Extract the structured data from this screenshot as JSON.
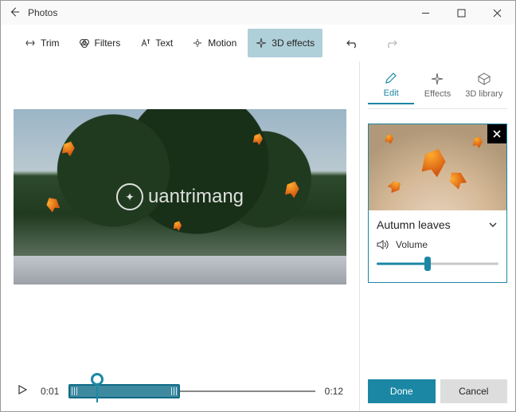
{
  "app_title": "Photos",
  "toolbar": {
    "trim": "Trim",
    "filters": "Filters",
    "text": "Text",
    "motion": "Motion",
    "effects3d": "3D effects"
  },
  "timeline": {
    "current": "0:01",
    "duration": "0:12"
  },
  "panel": {
    "tabs": {
      "edit": "Edit",
      "effects": "Effects",
      "library": "3D library"
    },
    "effect": {
      "name": "Autumn leaves",
      "volume_label": "Volume",
      "volume_value": 42
    }
  },
  "footer": {
    "done": "Done",
    "cancel": "Cancel"
  },
  "watermark": "uantrimang",
  "colors": {
    "accent": "#1b87a5"
  }
}
